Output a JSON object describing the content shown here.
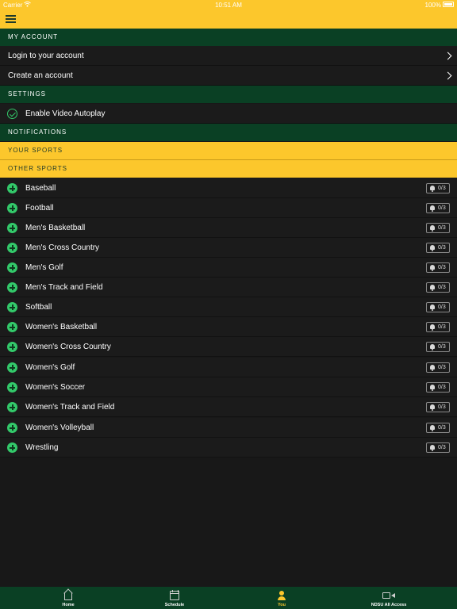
{
  "status_bar": {
    "carrier": "Carrier",
    "time": "10:51 AM",
    "battery": "100%"
  },
  "my_account": {
    "header": "MY ACCOUNT",
    "items": [
      {
        "label": "Login to your account"
      },
      {
        "label": "Create an account"
      }
    ]
  },
  "settings": {
    "header": "SETTINGS",
    "autoplay_label": "Enable Video Autoplay",
    "autoplay_enabled": true
  },
  "notifications": {
    "header": "NOTIFICATIONS"
  },
  "your_sports": {
    "header": "YOUR SPORTS"
  },
  "other_sports": {
    "header": "OTHER SPORTS",
    "items": [
      {
        "name": "Baseball",
        "badge": "0/3"
      },
      {
        "name": "Football",
        "badge": "0/3"
      },
      {
        "name": "Men's Basketball",
        "badge": "0/3"
      },
      {
        "name": "Men's Cross Country",
        "badge": "0/3"
      },
      {
        "name": "Men's Golf",
        "badge": "0/3"
      },
      {
        "name": "Men's Track and Field",
        "badge": "0/3"
      },
      {
        "name": "Softball",
        "badge": "0/3"
      },
      {
        "name": "Women's Basketball",
        "badge": "0/3"
      },
      {
        "name": "Women's Cross Country",
        "badge": "0/3"
      },
      {
        "name": "Women's Golf",
        "badge": "0/3"
      },
      {
        "name": "Women's Soccer",
        "badge": "0/3"
      },
      {
        "name": "Women's Track and Field",
        "badge": "0/3"
      },
      {
        "name": "Women's Volleyball",
        "badge": "0/3"
      },
      {
        "name": "Wrestling",
        "badge": "0/3"
      }
    ]
  },
  "tabbar": {
    "tabs": [
      {
        "label": "Home",
        "icon": "home-icon",
        "active": false
      },
      {
        "label": "Schedule",
        "icon": "calendar-icon",
        "active": false
      },
      {
        "label": "You",
        "icon": "person-icon",
        "active": true
      },
      {
        "label": "NDSU All Access",
        "icon": "video-icon",
        "active": false
      }
    ]
  },
  "colors": {
    "gold": "#fcc72c",
    "green": "#0a4024",
    "accent_green": "#33c96a",
    "background": "#181818"
  }
}
